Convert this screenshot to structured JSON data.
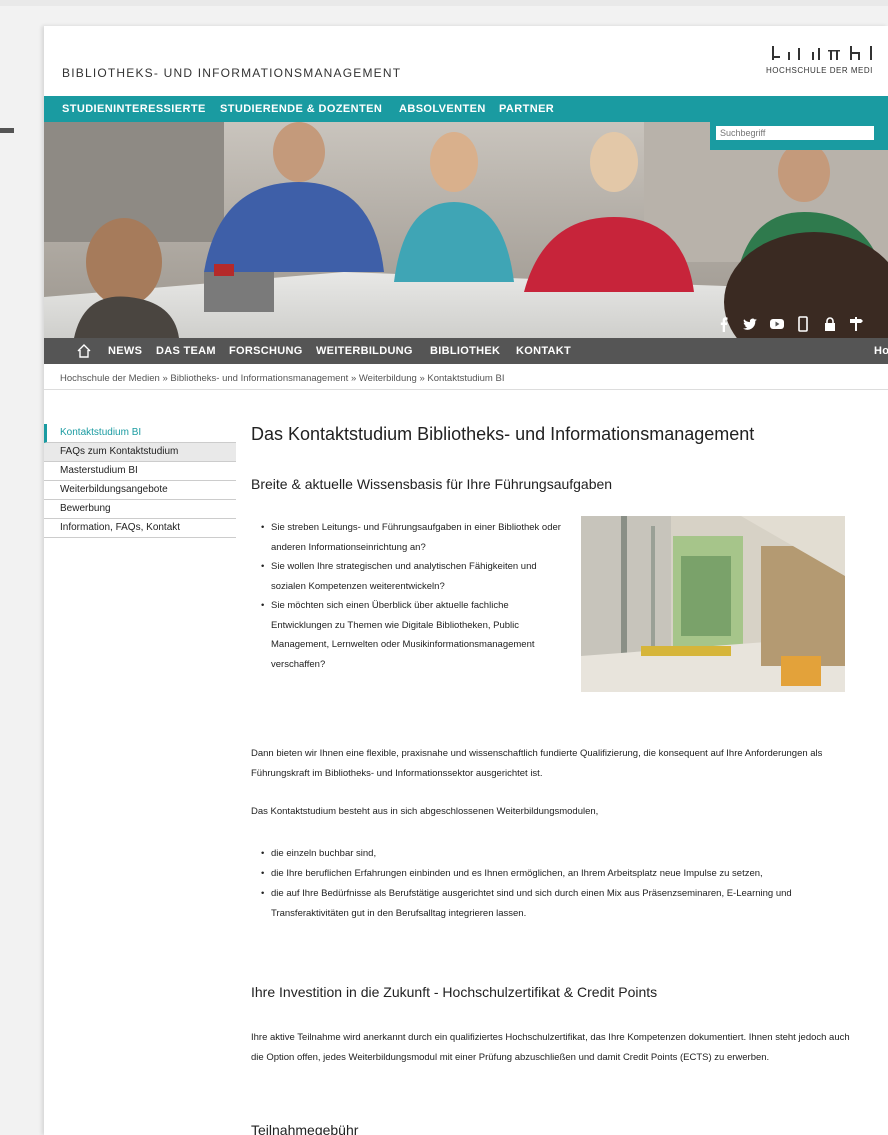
{
  "site": {
    "title": "BIBLIOTHEKS- UND INFORMATIONSMANAGEMENT",
    "logo_text": "HOCHSCHULE DER MEDI"
  },
  "topnav": [
    "STUDIENINTERESSIERTE",
    "STUDIERENDE & DOZENTEN",
    "ABSOLVENTEN",
    "PARTNER"
  ],
  "search": {
    "placeholder": "Suchbegriff"
  },
  "social_icons": [
    "facebook-icon",
    "twitter-icon",
    "youtube-icon",
    "mobile-icon",
    "lock-icon",
    "signpost-icon"
  ],
  "mainnav": [
    "NEWS",
    "DAS TEAM",
    "FORSCHUNG",
    "WEITERBILDUNG",
    "BIBLIOTHEK",
    "KONTAKT"
  ],
  "mainnav_right": "Ho",
  "breadcrumb": "Hochschule der Medien » Bibliotheks- und Informationsmanagement » Weiterbildung » Kontaktstudium BI",
  "sidebar": [
    "Kontaktstudium BI",
    "FAQs zum Kontaktstudium",
    "Masterstudium BI",
    "Weiterbildungsangebote",
    "Bewerbung",
    "Information, FAQs, Kontakt"
  ],
  "content": {
    "heading": "Das Kontaktstudium Bibliotheks- und Informationsmanagement",
    "subheading": "Breite & aktuelle Wissensbasis für Ihre Führungsaufgaben",
    "bullets1": [
      "Sie streben Leitungs- und Führungsaufgaben in einer Bibliothek oder anderen Informationseinrichtung an?",
      "Sie wollen Ihre strategischen und analytischen Fähigkeiten und sozialen Kompetenzen weiterentwickeln?",
      "Sie möchten sich einen Überblick über aktuelle fachliche Entwicklungen zu Themen wie Digitale Bibliotheken, Public Management, Lernwelten oder Musikinformationsmanagement verschaffen?"
    ],
    "para1": "Dann bieten wir Ihnen eine flexible, praxisnahe und wissenschaftlich fundierte Qualifizierung, die konsequent auf Ihre Anforderungen als Führungskraft im Bibliotheks- und Informationssektor ausgerichtet ist.",
    "para2": "Das Kontaktstudium besteht aus in sich abgeschlossenen Weiterbildungsmodulen,",
    "bullets2": [
      "die einzeln buchbar sind,",
      "die Ihre beruflichen Erfahrungen einbinden und es Ihnen ermöglichen, an Ihrem Arbeitsplatz neue Impulse zu setzen,",
      "die auf Ihre Bedürfnisse als Berufstätige ausgerichtet sind und sich durch einen Mix aus Präsenzseminaren, E-Learning und Transferaktivitäten gut in den Berufsalltag integrieren lassen."
    ],
    "heading2": "Ihre Investition in die Zukunft - Hochschulzertifikat & Credit Points",
    "para3": "Ihre aktive Teilnahme wird anerkannt durch ein qualifiziertes Hochschulzertifikat, das Ihre Kompetenzen dokumentiert. Ihnen steht jedoch auch die Option offen, jedes Weiterbildungsmodul mit einer Prüfung abzuschließen und damit Credit Points (ECTS) zu erwerben.",
    "heading3": "Teilnahmegebühr"
  }
}
